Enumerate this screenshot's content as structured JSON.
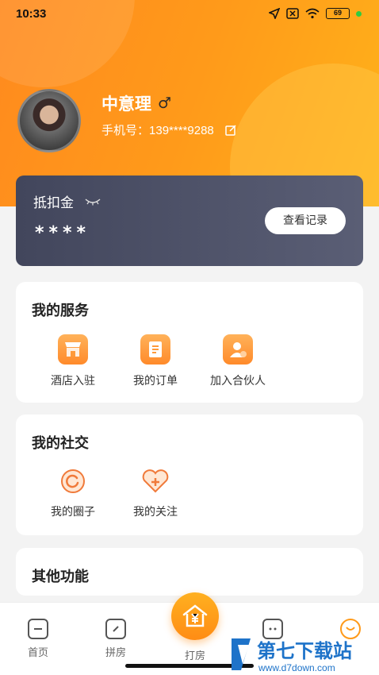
{
  "status_bar": {
    "time": "10:33",
    "battery": "69"
  },
  "profile": {
    "name": "中意理",
    "gender_symbol": "♂",
    "phone_label": "手机号：",
    "phone_value": "139****9288"
  },
  "deduction": {
    "title": "抵扣金",
    "value": "****",
    "record_button": "查看记录"
  },
  "services": {
    "title": "我的服务",
    "items": [
      {
        "label": "酒店入驻",
        "icon": "store-icon"
      },
      {
        "label": "我的订单",
        "icon": "order-icon"
      },
      {
        "label": "加入合伙人",
        "icon": "partner-icon"
      }
    ]
  },
  "social": {
    "title": "我的社交",
    "items": [
      {
        "label": "我的圈子",
        "icon": "circle-icon"
      },
      {
        "label": "我的关注",
        "icon": "heart-plus-icon"
      }
    ]
  },
  "other": {
    "title": "其他功能"
  },
  "nav": {
    "items": [
      {
        "label": "首页",
        "icon": "home-icon"
      },
      {
        "label": "拼房",
        "icon": "share-room-icon"
      },
      {
        "label": "打房",
        "icon": "yen-house-icon"
      },
      {
        "label": "",
        "icon": "message-icon"
      },
      {
        "label": "",
        "icon": "profile-smile-icon"
      }
    ]
  },
  "watermark": {
    "brand": "第七下载站",
    "url": "www.d7down.com"
  },
  "colors": {
    "accent": "#ff9a1a",
    "card_dark": "#4a4e65",
    "bg": "#f3f3f3"
  }
}
